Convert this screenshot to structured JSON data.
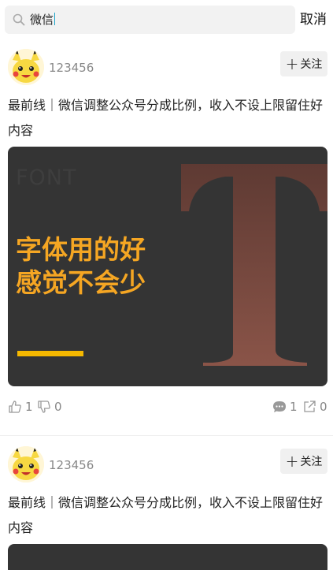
{
  "search": {
    "value": "微信",
    "cancel_label": "取消"
  },
  "posts": [
    {
      "username": "123456",
      "follow_label": "关注",
      "title": "最前线｜微信调整公众号分成比例，收入不设上限留住好内容",
      "image": {
        "watermark": "FONT",
        "headline_1": "字体用的好",
        "headline_2": "感觉不会少",
        "big_letter": "T"
      },
      "likes": "1",
      "dislikes": "0",
      "comments": "1",
      "shares": "0"
    },
    {
      "username": "123456",
      "follow_label": "关注",
      "title": "最前线｜微信调整公众号分成比例，收入不设上限留住好内容"
    }
  ],
  "colors": {
    "accent": "#f5a623",
    "bar": "#f5b800",
    "image_bg": "#343434",
    "big_letter": "#7a4a40"
  }
}
